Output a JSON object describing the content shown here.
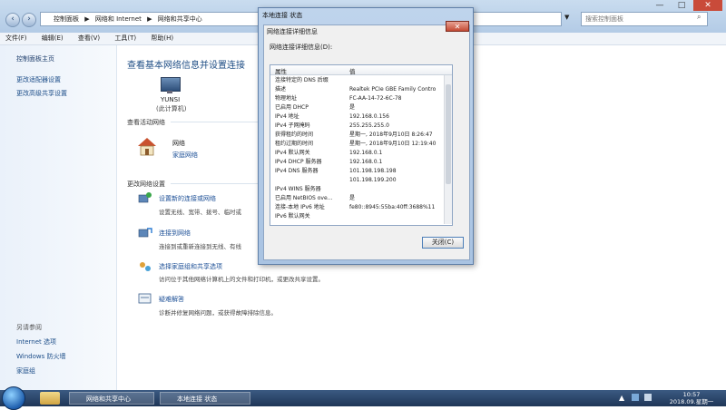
{
  "address": {
    "crumbs": [
      "控制面板",
      "▶",
      "网络和 Internet",
      "▶",
      "网络和共享中心",
      "▼"
    ],
    "search_placeholder": "搜索控制面板"
  },
  "menu": [
    "文件(F)",
    "编辑(E)",
    "查看(V)",
    "工具(T)",
    "帮助(H)"
  ],
  "left_pane": {
    "items": [
      "控制面板主页",
      "更改适配器设置",
      "更改高级共享设置"
    ],
    "see_also_title": "另请参阅",
    "see_also": [
      "Internet 选项",
      "Windows 防火墙",
      "家庭组"
    ]
  },
  "main": {
    "title": "查看基本网络信息并设置连接",
    "computer_name": "YUNSI",
    "computer_sub": "(此计算机)",
    "active_networks_label": "查看活动网络",
    "network_name": "网络",
    "network_type": "家庭网络",
    "change_settings_label": "更改网络设置",
    "tasks": [
      {
        "link": "设置新的连接或网络",
        "desc": "设置无线、宽带、拨号、临时或"
      },
      {
        "link": "连接到网络",
        "desc": "连接到或重新连接到无线、有线"
      },
      {
        "link": "选择家庭组和共享选项",
        "desc": "访问位于其他网络计算机上的文件和打印机，或更改共享设置。"
      },
      {
        "link": "疑难解答",
        "desc": "诊断并修复网络问题，或获得故障排除信息。"
      }
    ]
  },
  "dialog": {
    "window_title": "本地连接 状态",
    "title": "网络连接详细信息",
    "label": "网络连接详细信息(D):",
    "col_property": "属性",
    "col_value": "值",
    "rows": [
      {
        "p": "连接特定的 DNS 后缀",
        "v": ""
      },
      {
        "p": "描述",
        "v": "Realtek PCIe GBE Family Contro"
      },
      {
        "p": "物理地址",
        "v": "FC-AA-14-72-6C-78"
      },
      {
        "p": "已启用 DHCP",
        "v": "是"
      },
      {
        "p": "IPv4 地址",
        "v": "192.168.0.156"
      },
      {
        "p": "IPv4 子网掩码",
        "v": "255.255.255.0"
      },
      {
        "p": "获得租约的时间",
        "v": "星期一, 2018年9月10日 8:26:47"
      },
      {
        "p": "租约过期的时间",
        "v": "星期一, 2018年9月10日 12:19:40"
      },
      {
        "p": "IPv4 默认网关",
        "v": "192.168.0.1"
      },
      {
        "p": "IPv4 DHCP 服务器",
        "v": "192.168.0.1"
      },
      {
        "p": "IPv4 DNS 服务器",
        "v": "101.198.198.198"
      },
      {
        "p": "",
        "v": "101.198.199.200"
      },
      {
        "p": "IPv4 WINS 服务器",
        "v": ""
      },
      {
        "p": "已启用 NetBIOS ove...",
        "v": "是"
      },
      {
        "p": "连接-本地 IPv6 地址",
        "v": "fe80::8945:55ba:40ff:3688%11"
      },
      {
        "p": "IPv6 默认网关",
        "v": ""
      }
    ],
    "close_label": "关闭(C)"
  },
  "taskbar": {
    "items": [
      "网络和共享中心",
      "本地连接 状态"
    ],
    "time": "10:57",
    "date": "2018.09.星期一"
  }
}
